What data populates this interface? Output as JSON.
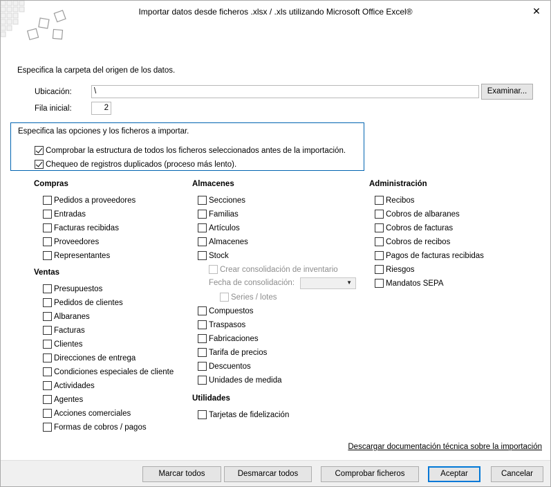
{
  "window": {
    "title": "Importar datos desde ficheros .xlsx / .xls utilizando Microsoft Office Excel®",
    "close_glyph": "✕"
  },
  "origin": {
    "heading": "Especifica la carpeta del origen de los datos.",
    "location_label": "Ubicación:",
    "location_value": "\\",
    "browse_label": "Examinar...",
    "start_row_label": "Fila inicial:",
    "start_row_value": "2"
  },
  "options": {
    "heading": "Especifica las opciones y los ficheros a importar.",
    "items": [
      {
        "label": "Comprobar la estructura de todos los ficheros seleccionados antes de la importación.",
        "checked": true
      },
      {
        "label": "Chequeo de registros duplicados (proceso más lento).",
        "checked": true
      }
    ]
  },
  "groups": {
    "compras": {
      "title": "Compras",
      "items": [
        "Pedidos a proveedores",
        "Entradas",
        "Facturas recibidas",
        "Proveedores",
        "Representantes"
      ]
    },
    "ventas": {
      "title": "Ventas",
      "items": [
        "Presupuestos",
        "Pedidos de clientes",
        "Albaranes",
        "Facturas",
        "Clientes",
        "Direcciones de entrega",
        "Condiciones especiales de cliente",
        "Actividades",
        "Agentes",
        "Acciones comerciales",
        "Formas de cobros / pagos"
      ]
    },
    "almacenes": {
      "title": "Almacenes",
      "items_top": [
        "Secciones",
        "Familias",
        "Artículos",
        "Almacenes",
        "Stock"
      ],
      "consolidation_checkbox": "Crear consolidación de inventario",
      "consolidation_date_label": "Fecha de consolidación:",
      "consolidation_date_value": "",
      "series_lotes": "Series / lotes",
      "items_bottom": [
        "Compuestos",
        "Traspasos",
        "Fabricaciones",
        "Tarifa de precios",
        "Descuentos",
        "Unidades de medida"
      ]
    },
    "utilidades": {
      "title": "Utilidades",
      "items": [
        "Tarjetas de fidelización"
      ]
    },
    "administracion": {
      "title": "Administración",
      "items": [
        "Recibos",
        "Cobros de albaranes",
        "Cobros de facturas",
        "Cobros de recibos",
        "Pagos de facturas recibidas",
        "Riesgos",
        "Mandatos SEPA"
      ]
    }
  },
  "link": {
    "label": "Descargar documentación técnica sobre la importación"
  },
  "buttons": {
    "mark_all": "Marcar todos",
    "unmark_all": "Desmarcar todos",
    "check_files": "Comprobar ficheros",
    "accept": "Aceptar",
    "cancel": "Cancelar"
  },
  "colors": {
    "focus_border": "#0063b1",
    "bottom_bar": "#f0f0f0"
  }
}
